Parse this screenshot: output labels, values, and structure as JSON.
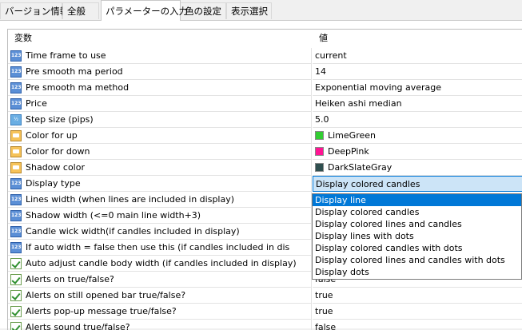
{
  "tabs": [
    {
      "label": "バージョン情報",
      "active": false
    },
    {
      "label": "全般",
      "active": false
    },
    {
      "label": "パラメーターの入力",
      "active": true
    },
    {
      "label": "色の設定",
      "active": false
    },
    {
      "label": "表示選択",
      "active": false
    }
  ],
  "grid": {
    "col_name": "変数",
    "col_value": "値",
    "rows": [
      {
        "icon": "number-icon",
        "name": "Time frame to use",
        "value": "current"
      },
      {
        "icon": "number-icon",
        "name": "Pre smooth ma period",
        "value": "14"
      },
      {
        "icon": "number-icon",
        "name": "Pre smooth ma method",
        "value": "Exponential moving average"
      },
      {
        "icon": "number-icon",
        "name": "Price",
        "value": "Heiken ashi median"
      },
      {
        "icon": "fraction-icon",
        "name": "Step size (pips)",
        "value": "5.0"
      },
      {
        "icon": "color-icon",
        "name": "Color for up",
        "value": "LimeGreen",
        "swatch": "#32cd32"
      },
      {
        "icon": "color-icon",
        "name": "Color for down",
        "value": "DeepPink",
        "swatch": "#ff1493"
      },
      {
        "icon": "color-icon",
        "name": "Shadow color",
        "value": "DarkSlateGray",
        "swatch": "#2f4f4f"
      },
      {
        "icon": "number-icon",
        "name": "Display type",
        "value": "Display colored candles",
        "selected": true
      },
      {
        "icon": "number-icon",
        "name": "Lines width (when lines are included in display)",
        "value": ""
      },
      {
        "icon": "number-icon",
        "name": "Shadow width (<=0 main line width+3)",
        "value": ""
      },
      {
        "icon": "number-icon",
        "name": "Candle wick width(if candles included in display)",
        "value": ""
      },
      {
        "icon": "number-icon",
        "name": "If auto width = false then use this (if candles included in dis",
        "value": ""
      },
      {
        "icon": "check-icon",
        "name": "Auto adjust candle body width (if candles included in display)",
        "value": ""
      },
      {
        "icon": "check-icon",
        "name": "Alerts on true/false?",
        "value": "false"
      },
      {
        "icon": "check-icon",
        "name": "Alerts on still opened bar true/false?",
        "value": "true"
      },
      {
        "icon": "check-icon",
        "name": "Alerts pop-up message true/false?",
        "value": "true"
      },
      {
        "icon": "check-icon",
        "name": "Alerts sound true/false?",
        "value": "false"
      }
    ]
  },
  "dropdown": {
    "highlighted": 0,
    "options": [
      "Display line",
      "Display colored candles",
      "Display colored lines and candles",
      "Display lines with dots",
      "Display colored candles with dots",
      "Display colored lines and candles with dots",
      "Display dots"
    ]
  }
}
